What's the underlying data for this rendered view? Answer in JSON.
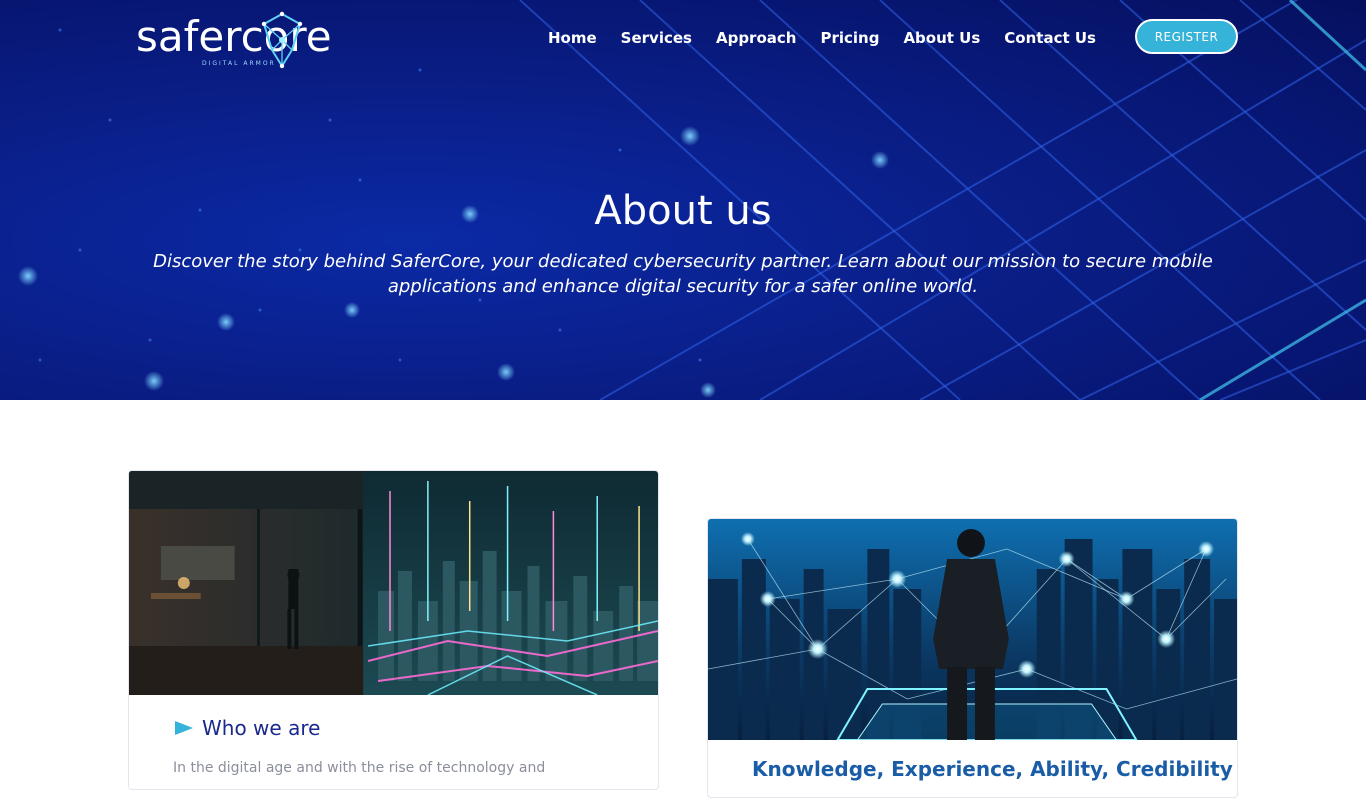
{
  "brand": {
    "name": "safercore",
    "tagline": "DIGITAL ARMOR"
  },
  "nav": {
    "items": [
      "Home",
      "Services",
      "Approach",
      "Pricing",
      "About Us",
      "Contact Us"
    ],
    "register_label": "REGISTER"
  },
  "hero": {
    "title": "About us",
    "subtitle": "Discover the story behind SaferCore, your dedicated cybersecurity partner. Learn about our mission to secure mobile applications and enhance digital security for a safer online world."
  },
  "cards": {
    "who": {
      "heading": "Who we are",
      "text": "In the digital age and with the rise of technology and"
    },
    "values": {
      "heading": "Knowledge, Experience, Ability, Credibility"
    }
  },
  "colors": {
    "hero_bg": "#0a1f8a",
    "accent": "#35b3d8",
    "heading": "#1a2a8c"
  }
}
